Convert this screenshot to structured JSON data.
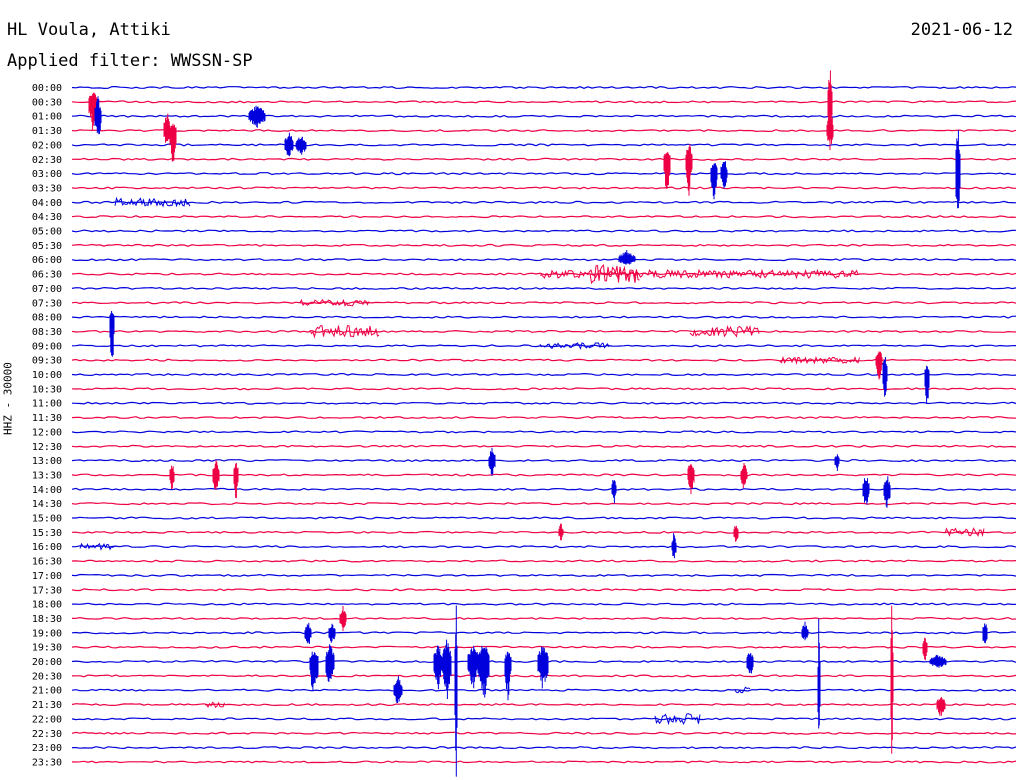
{
  "header": {
    "station": "HL Voula, Attiki",
    "date": "2021-06-12",
    "filter": "Applied filter: WWSSN-SP"
  },
  "channel_label": "HHZ - 30000",
  "colors": {
    "line_a": "#0000dd",
    "line_b": "#ee0044"
  },
  "rows": [
    "00:00",
    "00:30",
    "01:00",
    "01:30",
    "02:00",
    "02:30",
    "03:00",
    "03:30",
    "04:00",
    "04:30",
    "05:00",
    "05:30",
    "06:00",
    "06:30",
    "07:00",
    "07:30",
    "08:00",
    "08:30",
    "09:00",
    "09:30",
    "10:00",
    "10:30",
    "11:00",
    "11:30",
    "12:00",
    "12:30",
    "13:00",
    "13:30",
    "14:00",
    "14:30",
    "15:00",
    "15:30",
    "16:00",
    "16:30",
    "17:00",
    "17:30",
    "18:00",
    "18:30",
    "19:00",
    "19:30",
    "20:00",
    "20:30",
    "21:00",
    "21:30",
    "22:00",
    "22:30",
    "23:00",
    "23:30"
  ]
}
